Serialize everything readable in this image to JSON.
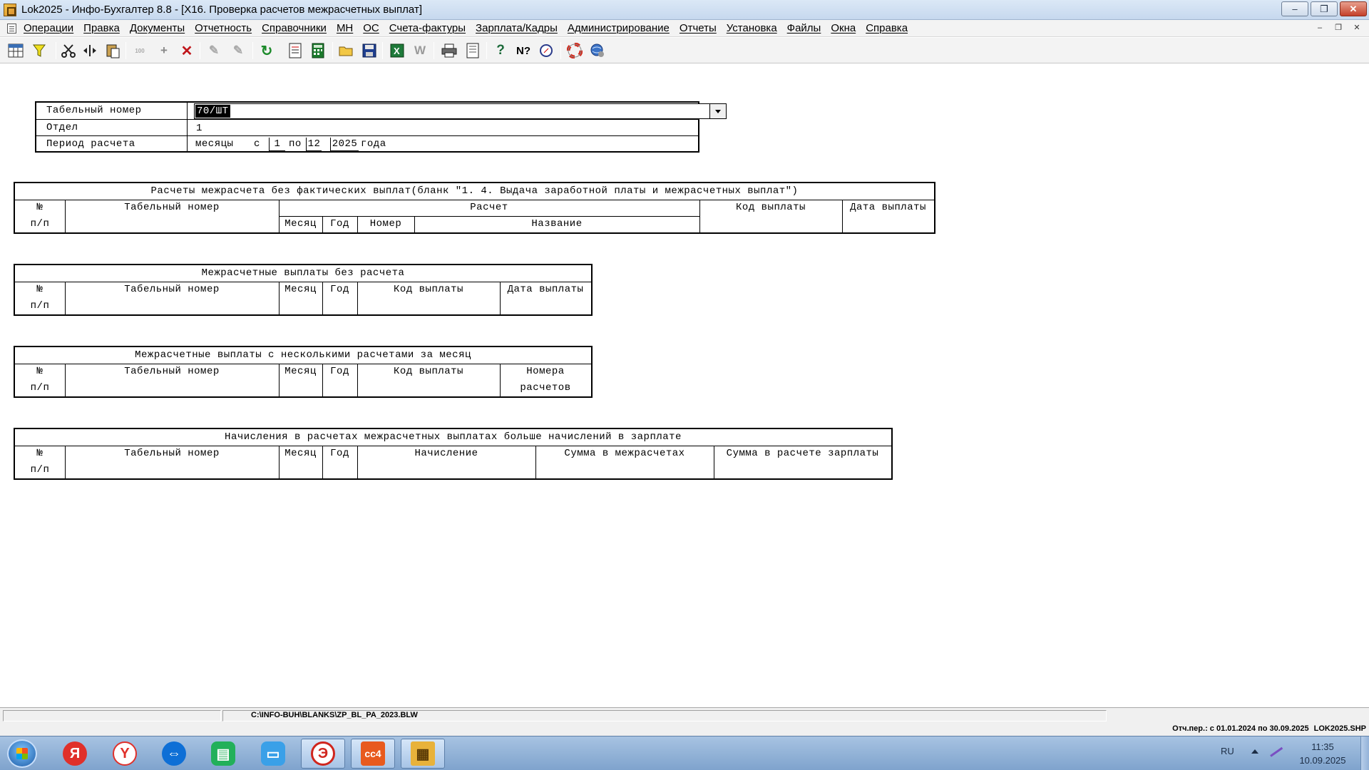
{
  "window": {
    "title": "Lok2025 - Инфо-Бухгалтер 8.8 - [X16. Проверка расчетов межрасчетных выплат]",
    "minimize": "–",
    "restore": "❐",
    "close": "✕"
  },
  "menu": {
    "items": [
      "Операции",
      "Правка",
      "Документы",
      "Отчетность",
      "Справочники",
      "МН",
      "ОС",
      "Счета-фактуры",
      "Зарплата/Кадры",
      "Администрирование",
      "Отчеты",
      "Установка",
      "Файлы",
      "Окна",
      "Справка"
    ],
    "mdi_minimize": "–",
    "mdi_restore": "❐",
    "mdi_close": "✕"
  },
  "toolbar": {
    "icons": [
      "table-icon",
      "filter-icon",
      "cut-icon",
      "move-columns-icon",
      "paste-icon",
      "count-icon",
      "add-icon",
      "delete-icon",
      "tool-disabled-icon",
      "tool-disabled-2-icon",
      "refresh-icon",
      "export-icon",
      "calculator-icon",
      "open-folder-icon",
      "save-icon",
      "excel-icon",
      "word-icon",
      "print-icon",
      "preview-icon",
      "help-icon",
      "context-help-icon",
      "compass-icon",
      "lifebuoy-icon",
      "web-icon"
    ]
  },
  "form": {
    "tab_label": "Табельный номер",
    "tab_value": "70/ШТ",
    "dept_label": "Отдел",
    "dept_value": "1",
    "period_label": "Период расчета",
    "period_months": "месяцы",
    "period_from": "с",
    "period_from_value": "1",
    "period_to": "по",
    "period_to_value": "12",
    "period_year": "2025",
    "period_year_suffix": "года"
  },
  "table1": {
    "title": "Расчеты межрасчета без фактических выплат(бланк \"1. 4. Выдача заработной платы и межрасчетных выплат\")",
    "col_no_1": "№",
    "col_no_2": "п/п",
    "col_tab": "Табельный номер",
    "col_calc": "Расчет",
    "col_month": "Месяц",
    "col_year": "Год",
    "col_number": "Номер",
    "col_name": "Название",
    "col_code": "Код выплаты",
    "col_date": "Дата выплаты"
  },
  "table2": {
    "title": "Межрасчетные выплаты без расчета",
    "col_no_1": "№",
    "col_no_2": "п/п",
    "col_tab": "Табельный номер",
    "col_month": "Месяц",
    "col_year": "Год",
    "col_code": "Код выплаты",
    "col_date": "Дата выплаты"
  },
  "table3": {
    "title": "Межрасчетные выплаты с несколькими расчетами за месяц",
    "col_no_1": "№",
    "col_no_2": "п/п",
    "col_tab": "Табельный номер",
    "col_month": "Месяц",
    "col_year": "Год",
    "col_code": "Код выплаты",
    "col_nums_1": "Номера",
    "col_nums_2": "расчетов"
  },
  "table4": {
    "title": "Начисления в расчетах межрасчетных выплатах больше начислений в зарплате",
    "col_no_1": "№",
    "col_no_2": "п/п",
    "col_tab": "Табельный номер",
    "col_month": "Месяц",
    "col_year": "Год",
    "col_accrual": "Начисление",
    "col_sum_inter": "Сумма в межрасчетах",
    "col_sum_salary": "Сумма в расчете зарплаты"
  },
  "status": {
    "path": "C:\\INFO-BUH\\BLANKS\\ZP_BL_PA_2023.BLW",
    "period_info": "Отч.пер.: с 01.01.2024 по 30.09.2025",
    "db_name": "LOK2025.SHP"
  },
  "taskbar": {
    "lang": "RU",
    "time": "11:35",
    "date": "10.09.2025"
  },
  "colors": {
    "titlebar": "#c6d8ee",
    "taskbar": "#7fa3cd",
    "selection": "#000000"
  }
}
